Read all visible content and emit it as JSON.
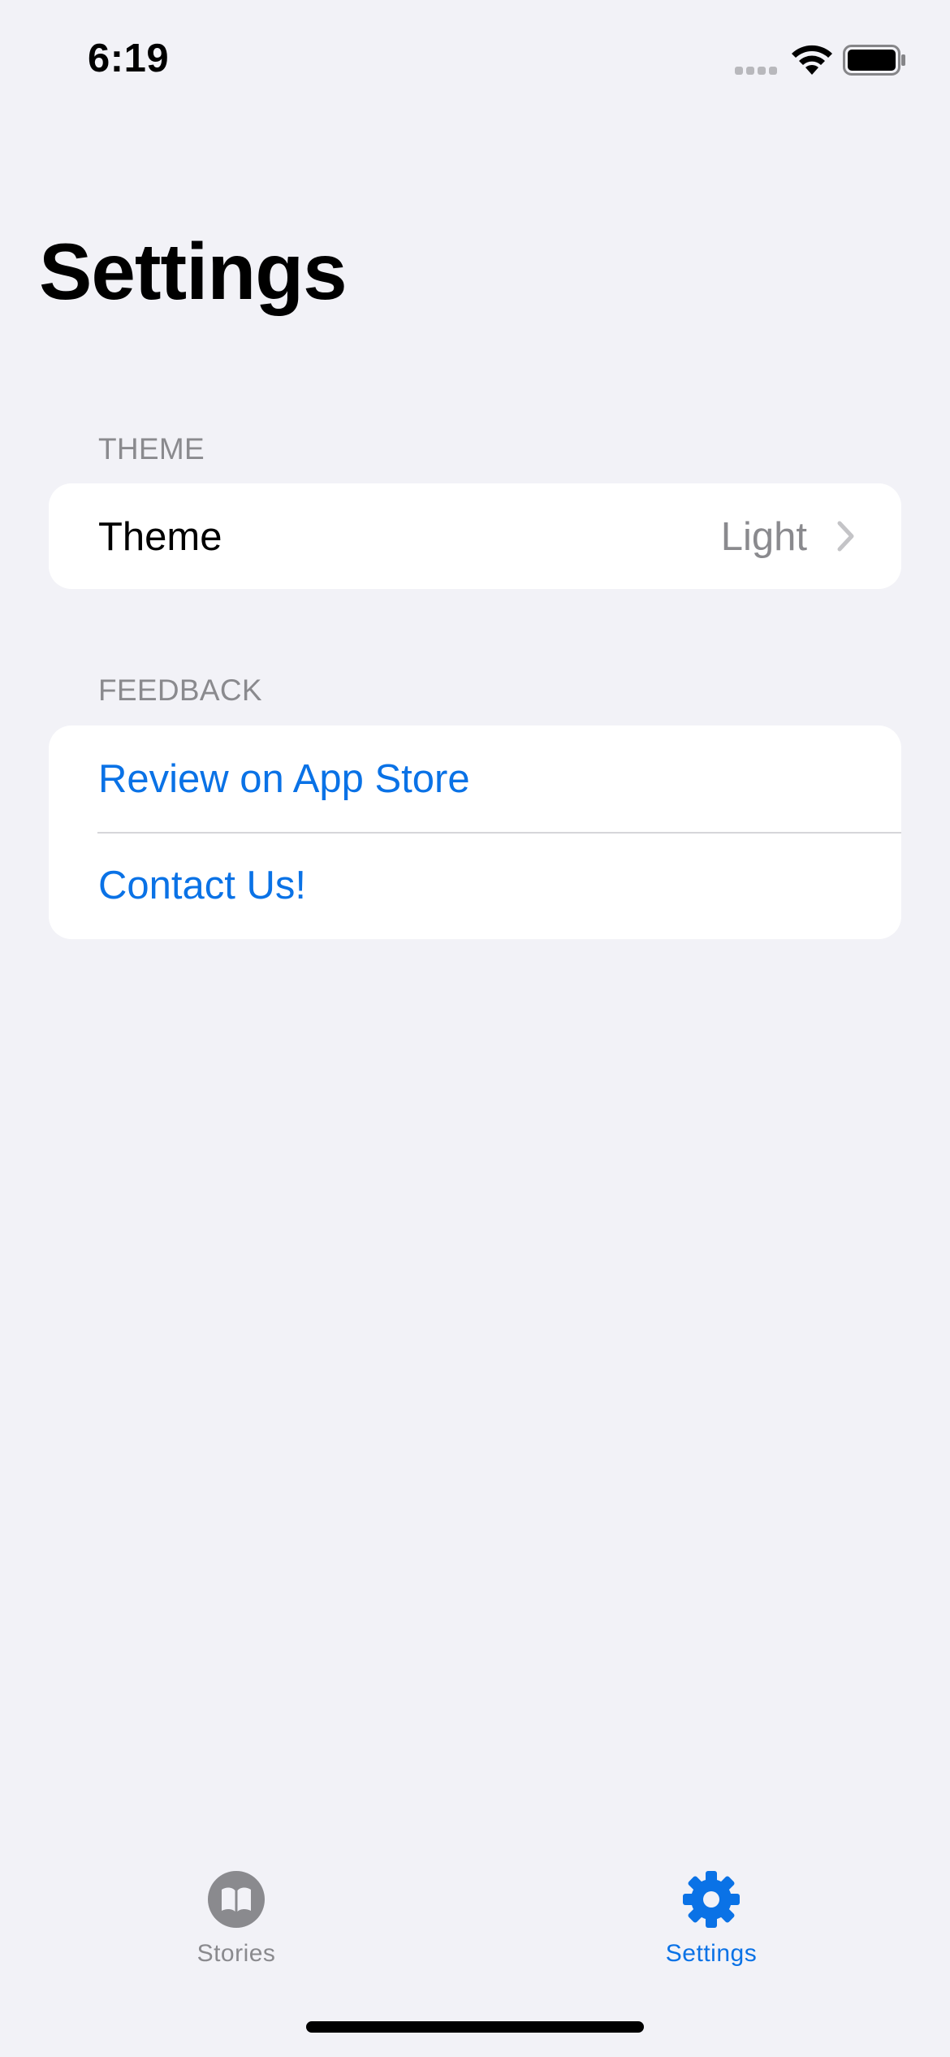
{
  "status_bar": {
    "time": "6:19",
    "icons": [
      "signal-icon",
      "wifi-icon",
      "battery-icon"
    ]
  },
  "page": {
    "title": "Settings"
  },
  "sections": {
    "theme": {
      "header": "THEME",
      "rows": [
        {
          "label": "Theme",
          "value": "Light",
          "icon": "chevron-right-icon"
        }
      ]
    },
    "feedback": {
      "header": "FEEDBACK",
      "rows": [
        {
          "label": "Review on App Store"
        },
        {
          "label": "Contact Us!"
        }
      ]
    }
  },
  "tab_bar": {
    "tabs": [
      {
        "label": "Stories",
        "icon": "book-icon",
        "selected": false
      },
      {
        "label": "Settings",
        "icon": "gear-icon",
        "selected": true
      }
    ]
  },
  "colors": {
    "accent": "#0a72e6",
    "background": "#f2f2f7",
    "secondary_text": "#8a8a8e",
    "card": "#ffffff"
  }
}
